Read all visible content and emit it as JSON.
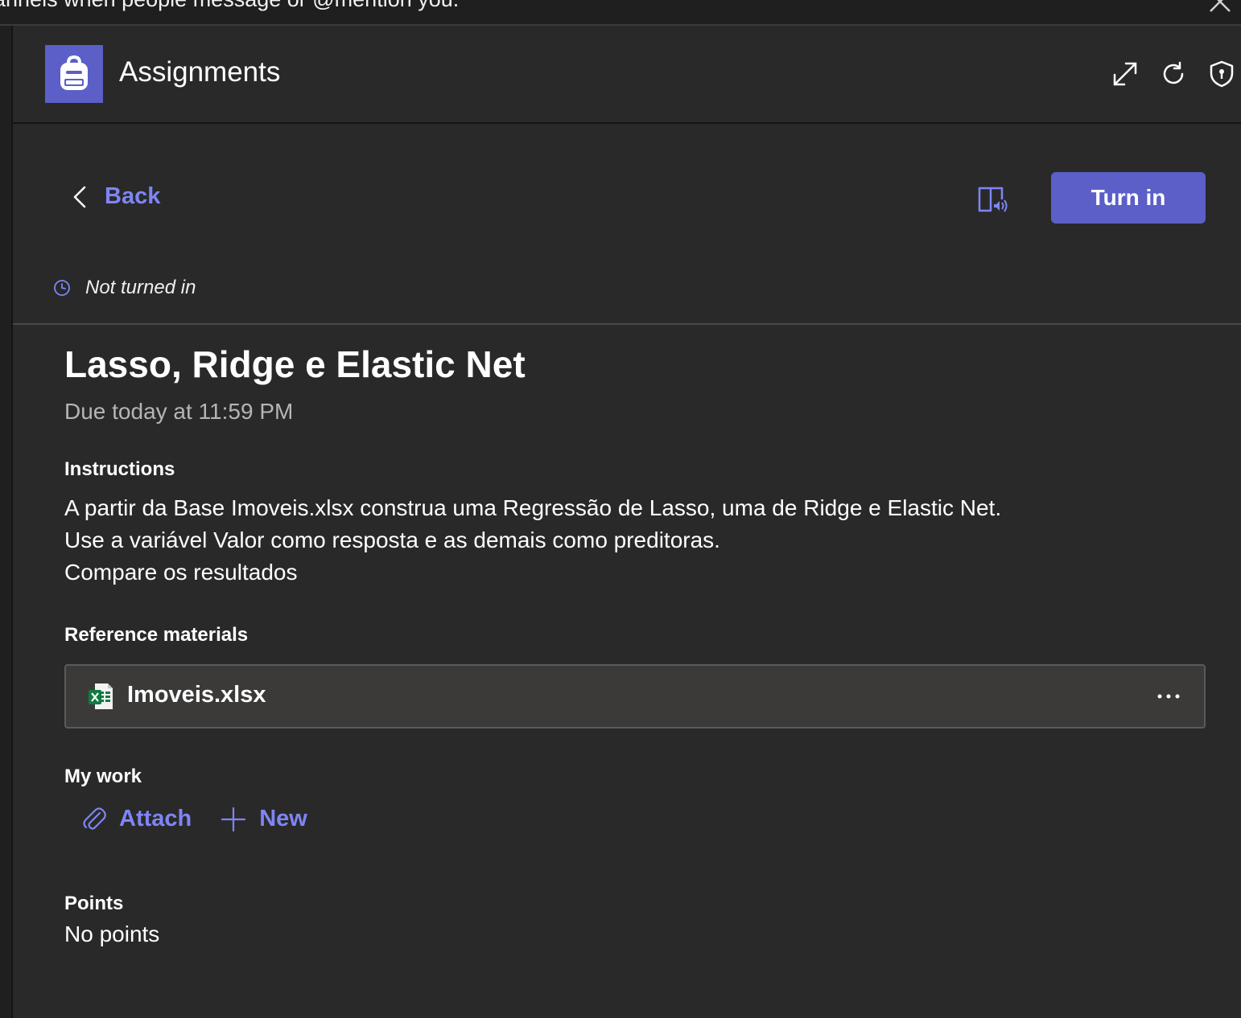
{
  "banner": {
    "text": "annels when people message or @mention you."
  },
  "header": {
    "app_title": "Assignments",
    "icons": [
      "expand-icon",
      "refresh-icon",
      "shield-icon"
    ]
  },
  "toolbar": {
    "back_label": "Back",
    "turn_in_label": "Turn in",
    "status": "Not turned in"
  },
  "assignment": {
    "title": "Lasso, Ridge e Elastic Net",
    "due": "Due today at 11:59 PM",
    "instructions_heading": "Instructions",
    "instructions": [
      "A partir da Base Imoveis.xlsx construa uma Regressão de Lasso, uma de Ridge e Elastic Net.",
      "Use a variável Valor como resposta e as demais como preditoras.",
      "Compare os resultados"
    ],
    "reference_heading": "Reference materials",
    "reference_file": "Imoveis.xlsx",
    "my_work_heading": "My work",
    "attach_label": "Attach",
    "new_label": "New",
    "points_heading": "Points",
    "points_value": "No points"
  },
  "colors": {
    "accent": "#5b5fc7",
    "link": "#7f85f5",
    "background": "#292929",
    "card": "#3b3a39",
    "excel_green": "#107c41"
  }
}
